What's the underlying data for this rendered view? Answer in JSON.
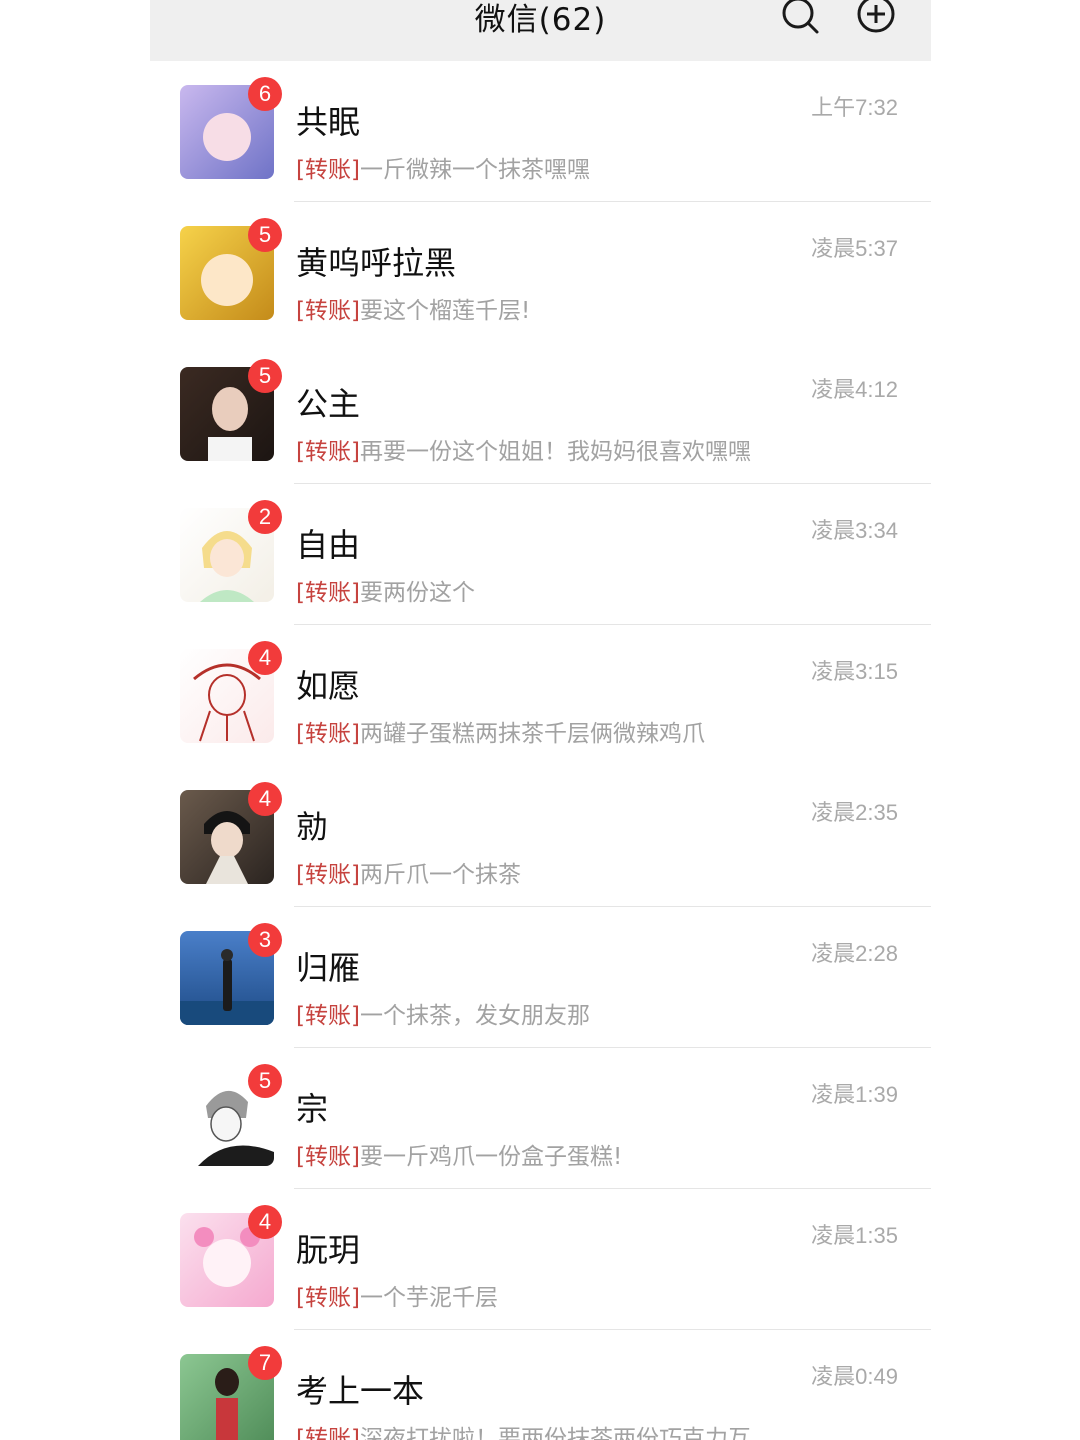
{
  "header": {
    "title": "微信(62)",
    "search_icon": "search-icon",
    "add_icon": "plus-circle-icon"
  },
  "colors": {
    "header_bg": "#efefef",
    "badge": "#f23b3b",
    "transfer_tag": "#c6433f",
    "preview_text": "#a2a2a2",
    "time_text": "#a9a9a9"
  },
  "chats": [
    {
      "name": "共眠",
      "unread": "6",
      "time": "上午7:32",
      "tag": "[转账]",
      "message": "一斤微辣一个抹茶嘿嘿",
      "avatar_bg": [
        "#c9b8ee",
        "#6f73c7"
      ]
    },
    {
      "name": "黄呜呼拉黑",
      "unread": "5",
      "time": "凌晨5:37",
      "tag": "[转账]",
      "message": "要这个榴莲千层!",
      "avatar_bg": [
        "#f6d24a",
        "#c48b1a"
      ]
    },
    {
      "name": "公主",
      "unread": "5",
      "time": "凌晨4:12",
      "tag": "[转账]",
      "message": "再要一份这个姐姐！我妈妈很喜欢嘿嘿",
      "avatar_bg": [
        "#3b2a22",
        "#1c1512"
      ]
    },
    {
      "name": "自由",
      "unread": "2",
      "time": "凌晨3:34",
      "tag": "[转账]",
      "message": "要两份这个",
      "avatar_bg": [
        "#ffffff",
        "#f3efe6"
      ]
    },
    {
      "name": "如愿",
      "unread": "4",
      "time": "凌晨3:15",
      "tag": "[转账]",
      "message": "两罐子蛋糕两抹茶千层俩微辣鸡爪",
      "avatar_bg": [
        "#ffffff",
        "#fbeaea"
      ]
    },
    {
      "name": "勍",
      "unread": "4",
      "time": "凌晨2:35",
      "tag": "[转账]",
      "message": "两斤爪一个抹茶",
      "avatar_bg": [
        "#6a5a4c",
        "#2b2420"
      ]
    },
    {
      "name": "归雁",
      "unread": "3",
      "time": "凌晨2:28",
      "tag": "[转账]",
      "message": "一个抹茶，发女朋友那",
      "avatar_bg": [
        "#4a7fc9",
        "#1e4b86"
      ]
    },
    {
      "name": "宗",
      "unread": "5",
      "time": "凌晨1:39",
      "tag": "[转账]",
      "message": "要一斤鸡爪一份盒子蛋糕!",
      "avatar_bg": [
        "#f2f2f2",
        "#bdbdbd"
      ]
    },
    {
      "name": "朊玥",
      "unread": "4",
      "time": "凌晨1:35",
      "tag": "[转账]",
      "message": "一个芋泥千层",
      "avatar_bg": [
        "#fbe0ee",
        "#f5a9cf"
      ]
    },
    {
      "name": "考上一本",
      "unread": "7",
      "time": "凌晨0:49",
      "tag": "[转账]",
      "message": "深夜打扰啦！要两份抹茶两份巧克力互...",
      "avatar_bg": [
        "#8cc792",
        "#4f8c58"
      ]
    }
  ]
}
